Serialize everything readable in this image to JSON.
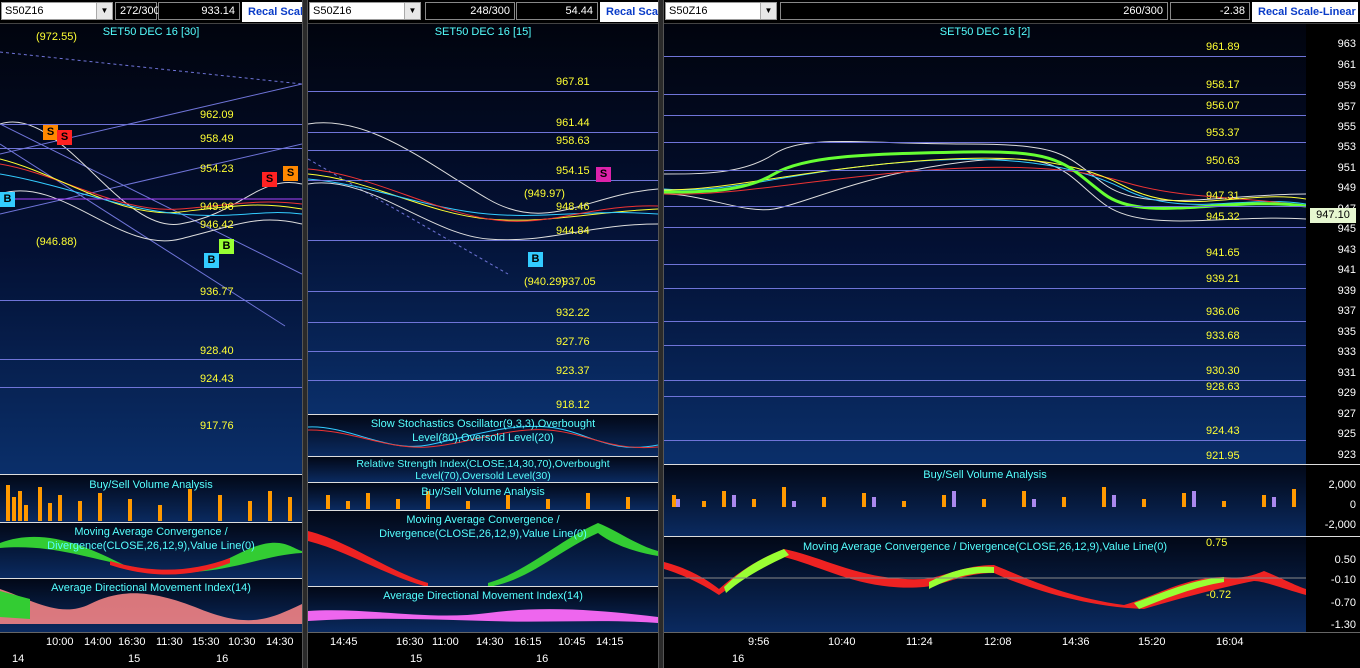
{
  "pane1": {
    "symbol": "S50Z16",
    "count": "272/300",
    "last": "933.14",
    "recal": "Recal Scale",
    "title": "SET50 DEC 16  [30]",
    "levels": [
      "962.09",
      "958.49",
      "954.23",
      "949.96",
      "946.42",
      "936.77",
      "928.40",
      "924.43",
      "917.76"
    ],
    "peak": "(972.55)",
    "low": "(946.88)",
    "sub1": "Buy/Sell Volume Analysis",
    "sub2": "Moving Average Convergence / Divergence(CLOSE,26,12,9),Value Line(0)",
    "sub3": "Average Directional Movement Index(14)",
    "xticks": [
      "10:00",
      "14:00",
      "16:30",
      "11:30",
      "15:30",
      "10:30",
      "14:30"
    ],
    "xdates": [
      "14",
      "15",
      "16"
    ]
  },
  "pane2": {
    "symbol": "S50Z16",
    "count": "248/300",
    "last": "54.44",
    "recal": "Recal Scale",
    "title": "SET50 DEC 16  [15]",
    "levels": [
      "967.81",
      "961.44",
      "958.63",
      "954.15",
      "948.46",
      "944.84",
      "937.05",
      "932.22",
      "927.76",
      "923.37",
      "918.12"
    ],
    "peak": "(949.97)",
    "low": "(940.29)",
    "sub1": "Slow Stochastics Oscillator(9,3,3),Overbought Level(80),Oversold Level(20)",
    "sub2": "Relative Strength Index(CLOSE,14,30,70),Overbought Level(70),Oversold Level(30)",
    "sub3": "Buy/Sell Volume Analysis",
    "sub4": "Moving Average Convergence / Divergence(CLOSE,26,12,9),Value Line(0)",
    "sub5": "Average Directional Movement Index(14)",
    "xticks": [
      "14:45",
      "16:30",
      "11:00",
      "14:30",
      "16:15",
      "10:45",
      "14:15"
    ],
    "xdates": [
      "15",
      "16"
    ]
  },
  "pane3": {
    "symbol": "S50Z16",
    "count": "260/300",
    "last": "-2.38",
    "recal": "Recal Scale-Linear",
    "title": "SET50 DEC 16  [2]",
    "levels": [
      "961.89",
      "958.17",
      "956.07",
      "953.37",
      "950.63",
      "947.31",
      "945.32",
      "941.65",
      "939.21",
      "936.06",
      "933.68",
      "930.30",
      "928.63",
      "924.43",
      "921.95"
    ],
    "yticks": [
      "963",
      "961",
      "959",
      "957",
      "955",
      "953",
      "951",
      "949",
      "947",
      "945",
      "943",
      "941",
      "939",
      "937",
      "935",
      "933",
      "931",
      "929",
      "927",
      "925",
      "923"
    ],
    "current": "947.10",
    "sub1": "Buy/Sell Volume Analysis",
    "vol_ticks": [
      "2,000",
      "0",
      "-2,000"
    ],
    "sub2": "Moving Average Convergence / Divergence(CLOSE,26,12,9),Value Line(0)",
    "macd_hi": "0.75",
    "macd_lo": "-0.72",
    "macd_ticks": [
      "0.50",
      "-0.10",
      "-0.70",
      "-1.30"
    ],
    "xticks": [
      "9:56",
      "10:40",
      "11:24",
      "12:08",
      "14:36",
      "15:20",
      "16:04"
    ],
    "xdates": [
      "16"
    ]
  },
  "markers": {
    "buy": "B",
    "sell": "S"
  },
  "colors": {
    "level": "#ffff33",
    "title": "#55ffff",
    "line": "#6f74d8",
    "recal": "#0a3cc8"
  }
}
